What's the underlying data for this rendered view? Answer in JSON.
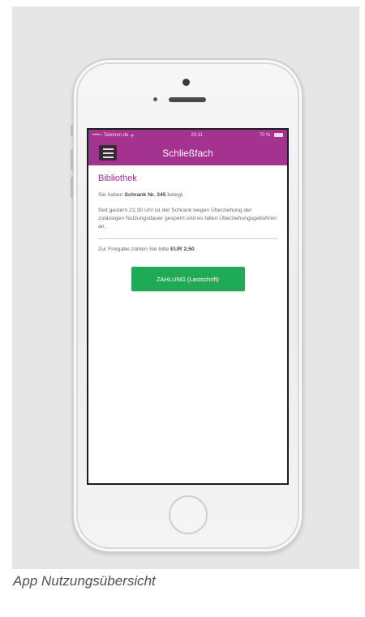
{
  "status_bar": {
    "carrier": "••••○ Telekom.de",
    "time": "20:11",
    "battery": "70 %"
  },
  "nav": {
    "title": "Schließfach",
    "menu_icon": "menu-icon"
  },
  "content": {
    "section_title": "Bibliothek",
    "locker_pre": "Sie haben ",
    "locker_bold": "Schrank Nr. 345",
    "locker_post": " belegt.",
    "notice": "Seit gestern 21:30 Uhr ist der Schrank wegen Überziehung der zulässigen Nutzungsdauer gesperrt und es fallen Überziehungsgebühren an.",
    "release_pre": "Zur Freigabe zahlen Sie bitte ",
    "release_bold": "EUR 2,50",
    "release_post": "."
  },
  "pay_button": {
    "label": "ZAHLUNG (Lastschrift)"
  },
  "caption": "App Nutzungsübersicht",
  "colors": {
    "accent": "#a3338f",
    "button": "#1faa55",
    "section_title": "#9b2f8a"
  }
}
